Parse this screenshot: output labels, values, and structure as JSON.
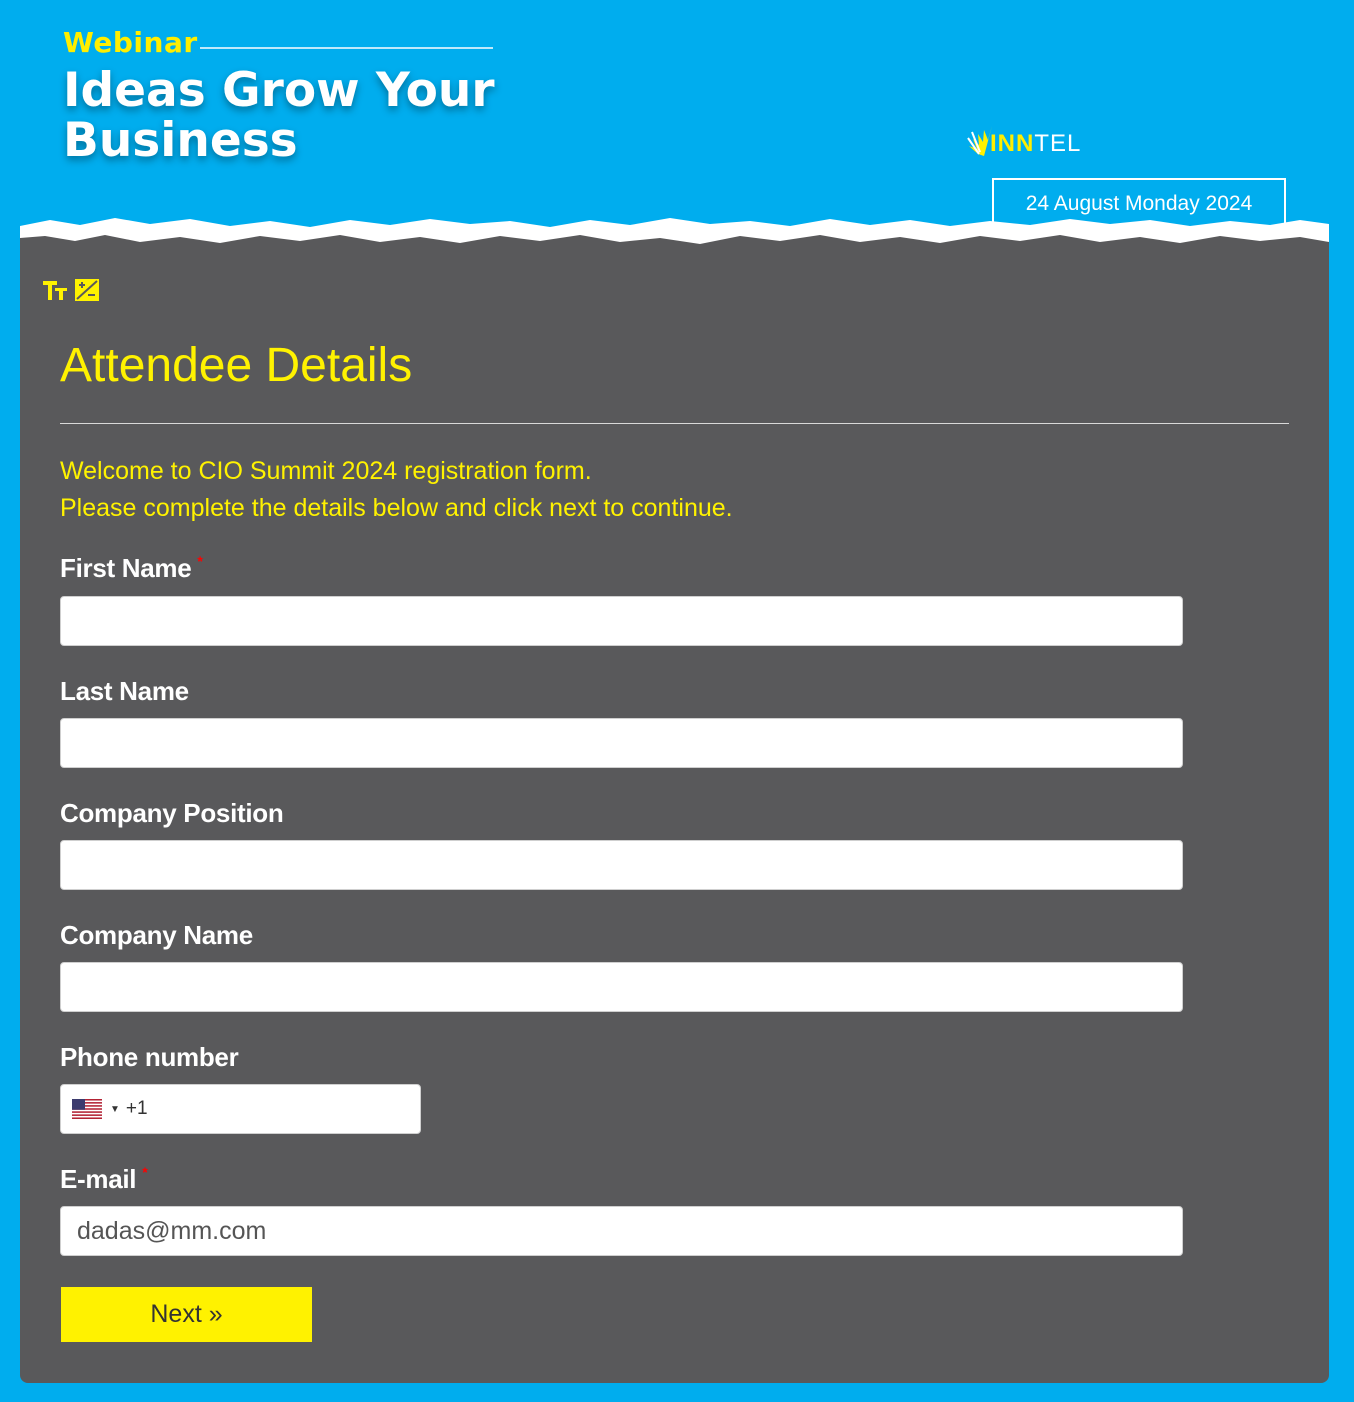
{
  "header": {
    "webinar_label": "Webinar",
    "headline": "Ideas Grow Your Business",
    "logo": {
      "part1": "INN",
      "part2": "TEL",
      "icon": "wing-logo-icon"
    },
    "date": "24 August Monday 2024"
  },
  "toolbar": {
    "icons": [
      "text-size-icon",
      "contrast-icon"
    ]
  },
  "form": {
    "title": "Attendee Details",
    "intro_line1": "Welcome to CIO Summit 2024 registration form.",
    "intro_line2": "Please complete the details below and click next to continue.",
    "fields": {
      "first_name": {
        "label": "First Name",
        "required_mark": "*",
        "value": ""
      },
      "last_name": {
        "label": "Last Name",
        "value": ""
      },
      "company_position": {
        "label": "Company Position",
        "value": ""
      },
      "company_name": {
        "label": "Company Name",
        "value": ""
      },
      "phone": {
        "label": "Phone number",
        "country_flag": "us-flag-icon",
        "dial_code": "+1",
        "value": ""
      },
      "email": {
        "label": "E-mail",
        "required_mark": "*",
        "value": "dadas@mm.com"
      }
    },
    "next_label": "Next »"
  },
  "colors": {
    "background": "#00adee",
    "panel": "#59595b",
    "accent": "#fff200",
    "required": "#ff0000"
  }
}
